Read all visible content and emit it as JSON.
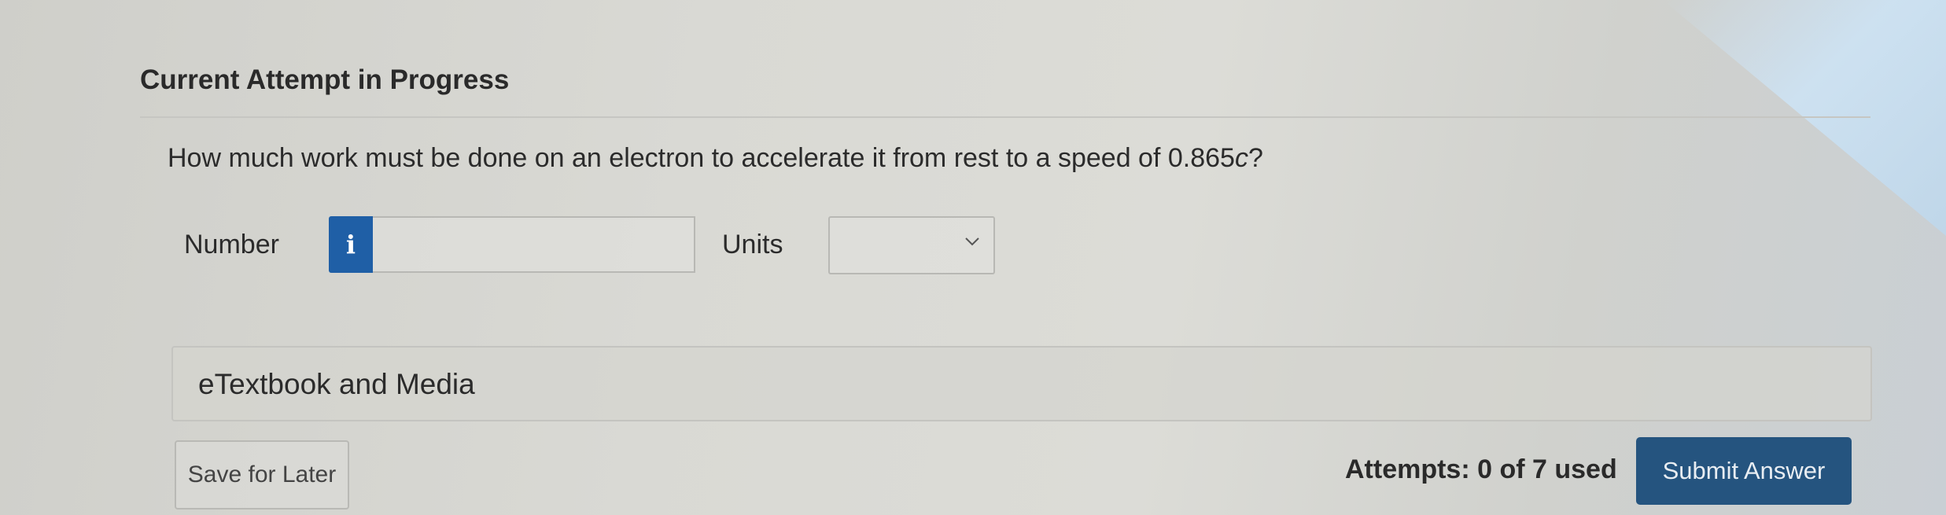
{
  "header": {
    "title": "Current Attempt in Progress"
  },
  "question": {
    "text_before": "How much work must be done on an electron to accelerate it from rest to a speed of 0.865",
    "variable": "c",
    "text_after": "?"
  },
  "answer": {
    "number_label": "Number",
    "info_glyph": "i",
    "number_value": "",
    "units_label": "Units",
    "units_selected": ""
  },
  "resources": {
    "etextbook_label": "eTextbook and Media"
  },
  "footer": {
    "save_label": "Save for Later",
    "attempts_text": "Attempts: 0 of 7 used",
    "submit_label": "Submit Answer"
  },
  "colors": {
    "info_button": "#1f5fa6",
    "submit_button": "#25547f"
  },
  "icons": {
    "info": "info-icon",
    "dropdown": "chevron-down-icon"
  }
}
